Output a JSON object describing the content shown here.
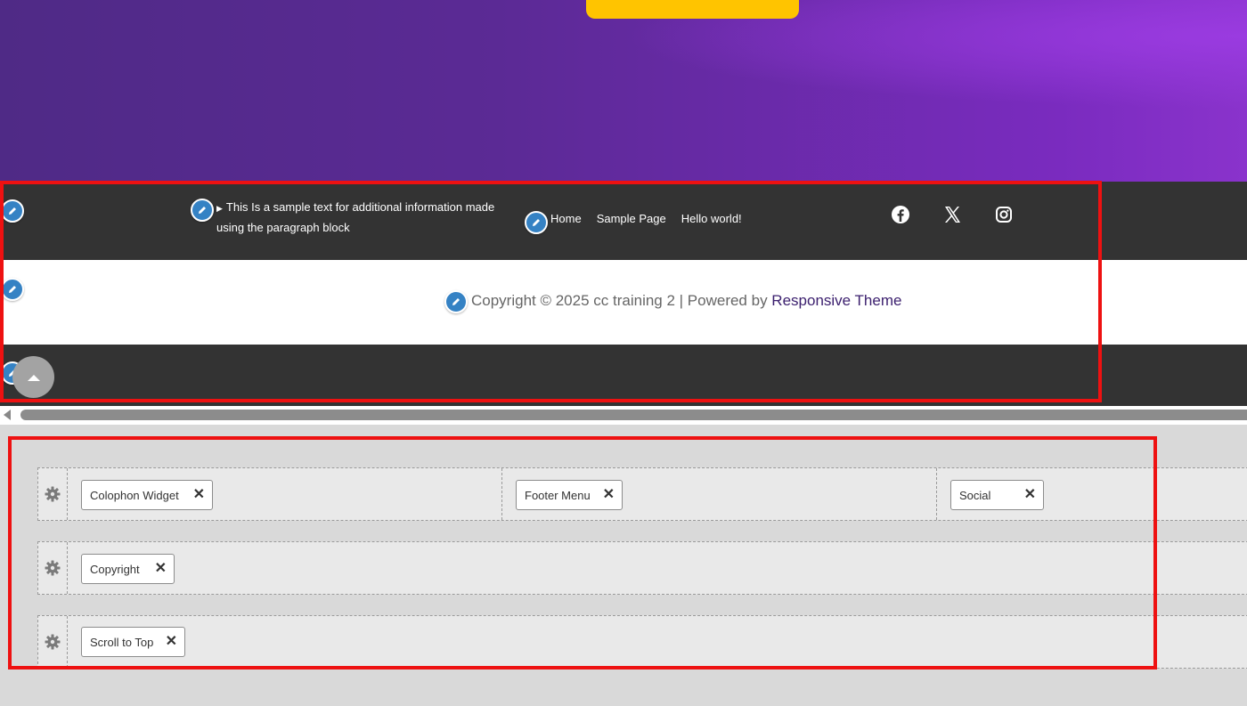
{
  "footer": {
    "paragraph_text": "This Is a sample text for additional information made using the paragraph block",
    "menu_items": [
      "Home",
      "Sample Page",
      "Hello world!"
    ],
    "social_icons": [
      "facebook-icon",
      "x-twitter-icon",
      "instagram-icon"
    ],
    "copyright_prefix": "Copyright © 2025 cc training 2 | Powered by ",
    "copyright_link": "Responsive Theme"
  },
  "builder": {
    "rows": [
      {
        "items": [
          "Colophon Widget",
          "Footer Menu",
          "Social"
        ]
      },
      {
        "items": [
          "Copyright"
        ]
      },
      {
        "items": [
          "Scroll to Top"
        ]
      }
    ]
  },
  "colors": {
    "accent_button": "#ffc400",
    "footer_dark": "#333333",
    "edit_pencil": "#3582c4",
    "highlight": "#ee1111"
  }
}
